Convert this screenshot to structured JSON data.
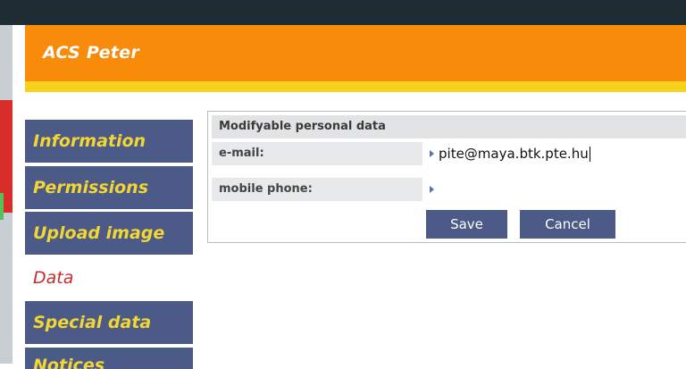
{
  "app": {
    "title": "ACS Peter"
  },
  "sidebar": {
    "items": [
      {
        "label": "Information",
        "active": false
      },
      {
        "label": "Permissions",
        "active": false
      },
      {
        "label": "Upload image",
        "active": false
      },
      {
        "label": "Data",
        "active": true
      },
      {
        "label": "Special data",
        "active": false
      },
      {
        "label": "Notices",
        "active": false
      }
    ]
  },
  "form": {
    "heading": "Modifyable personal data",
    "email": {
      "label": "e-mail:",
      "value": "pite@maya.btk.pte.hu"
    },
    "phone": {
      "label": "mobile phone:",
      "value": ""
    },
    "save_label": "Save",
    "cancel_label": "Cancel"
  },
  "colors": {
    "header": "#f88b0a",
    "accent_bar": "#f9d11c",
    "nav_bg": "#4b5a86",
    "nav_text": "#f2d633",
    "active_text": "#c62b2b"
  }
}
